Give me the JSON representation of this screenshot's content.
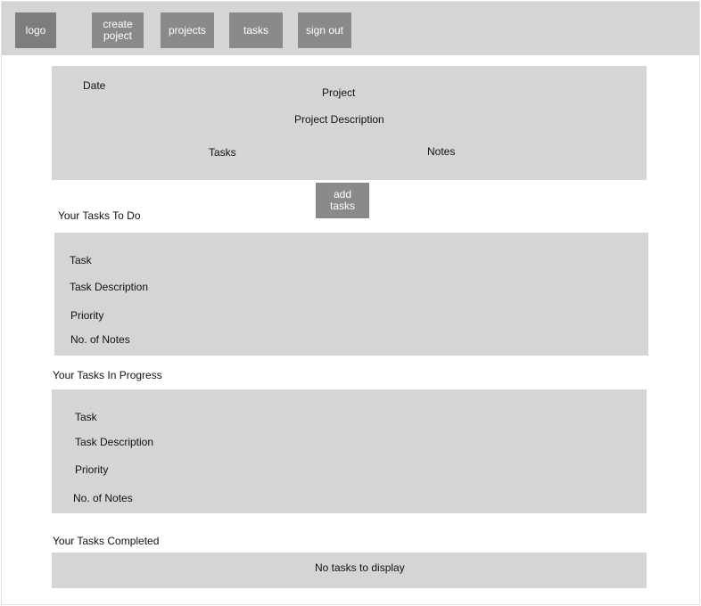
{
  "nav": {
    "logo": "logo",
    "create_project": "create\npoject",
    "projects": "projects",
    "tasks": "tasks",
    "sign_out": "sign out"
  },
  "project_card": {
    "date": "Date",
    "project": "Project",
    "description": "Project Description",
    "tasks": "Tasks",
    "notes": "Notes"
  },
  "add_tasks_label": "add\ntasks",
  "sections": {
    "todo": {
      "heading": "Your Tasks To Do",
      "task": "Task",
      "description": "Task Description",
      "priority": "Priority",
      "notes_count": "No. of Notes"
    },
    "in_progress": {
      "heading": "Your Tasks In Progress",
      "task": "Task",
      "description": "Task Description",
      "priority": "Priority",
      "notes_count": "No. of Notes"
    },
    "completed": {
      "heading": "Your Tasks Completed",
      "empty_text": "No tasks to display"
    }
  },
  "colors": {
    "panel": "#d5d5d5",
    "button": "#8a8a8a",
    "button_text": "#ffffff"
  }
}
